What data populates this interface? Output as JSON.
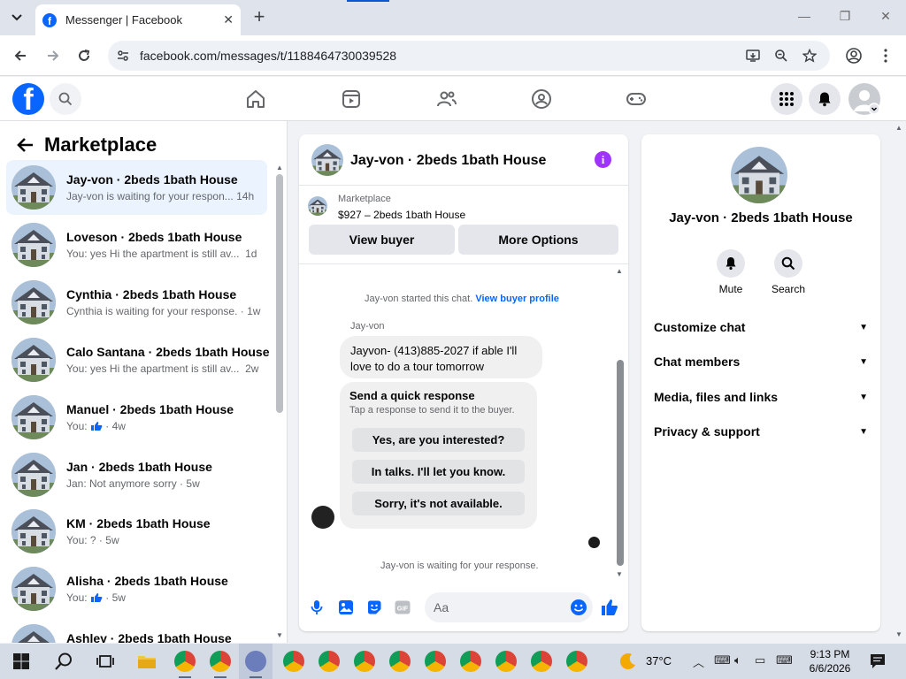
{
  "browser": {
    "tab_title": "Messenger | Facebook",
    "new_tab": "+",
    "url": "facebook.com/messages/t/1188464730039528",
    "window_controls": {
      "minimize": "—",
      "restore": "❐",
      "close": "✕"
    }
  },
  "sidebar": {
    "title": "Marketplace",
    "conversations": [
      {
        "name": "Jay-von · 2beds 1bath House",
        "preview": "Jay-von is waiting for your respon...",
        "time": "14h",
        "active": true
      },
      {
        "name": "Loveson · 2beds 1bath House",
        "preview": "You: yes Hi the apartment is still av...",
        "time": "1d"
      },
      {
        "name": "Cynthia · 2beds 1bath House",
        "preview": "Cynthia is waiting for your response.",
        "time": "1w"
      },
      {
        "name": "Calo Santana · 2beds 1bath House",
        "preview": "You: yes Hi the apartment is still av...",
        "time": "2w"
      },
      {
        "name": "Manuel · 2beds 1bath House",
        "preview": "You:",
        "time": "4w",
        "thumb_icon": true
      },
      {
        "name": "Jan · 2beds 1bath House",
        "preview": "Jan: Not anymore sorry",
        "time": "5w"
      },
      {
        "name": "KM · 2beds 1bath House",
        "preview": "You: ?",
        "time": "5w"
      },
      {
        "name": "Alisha · 2beds 1bath House",
        "preview": "You:",
        "time": "5w",
        "thumb_icon": true
      },
      {
        "name": "Ashley · 2beds 1bath House",
        "preview": "",
        "time": ""
      }
    ]
  },
  "chat": {
    "header_name": "Jay-von · 2beds 1bath House",
    "listing_source": "Marketplace",
    "listing_price": "$927 – 2beds 1bath House",
    "view_buyer": "View buyer",
    "more_options": "More Options",
    "started_text": "Jay-von started this chat.",
    "view_profile": "View buyer profile",
    "sender": "Jay-von",
    "message_line1": "Jayvon- (413)885-2027 if able I'll",
    "message_line2": "love to do a tour tomorrow",
    "quick_title": "Send a quick response",
    "quick_sub": "Tap a response to send it to the buyer.",
    "quick_options": [
      "Yes, are you interested?",
      "In talks. I'll let you know.",
      "Sorry, it's not available."
    ],
    "waiting": "Jay-von is waiting for your response.",
    "composer_placeholder": "Aa"
  },
  "info_panel": {
    "name": "Jay-von · 2beds 1bath House",
    "mute": "Mute",
    "search": "Search",
    "rows": [
      "Customize chat",
      "Chat members",
      "Media, files and links",
      "Privacy & support"
    ]
  },
  "taskbar": {
    "temperature": "37°C",
    "time": "9:13 PM",
    "date": "6/6/2026"
  },
  "colors": {
    "facebook_blue": "#0866ff",
    "info_purple": "#a033ff",
    "active_row": "#ebf3ff"
  }
}
